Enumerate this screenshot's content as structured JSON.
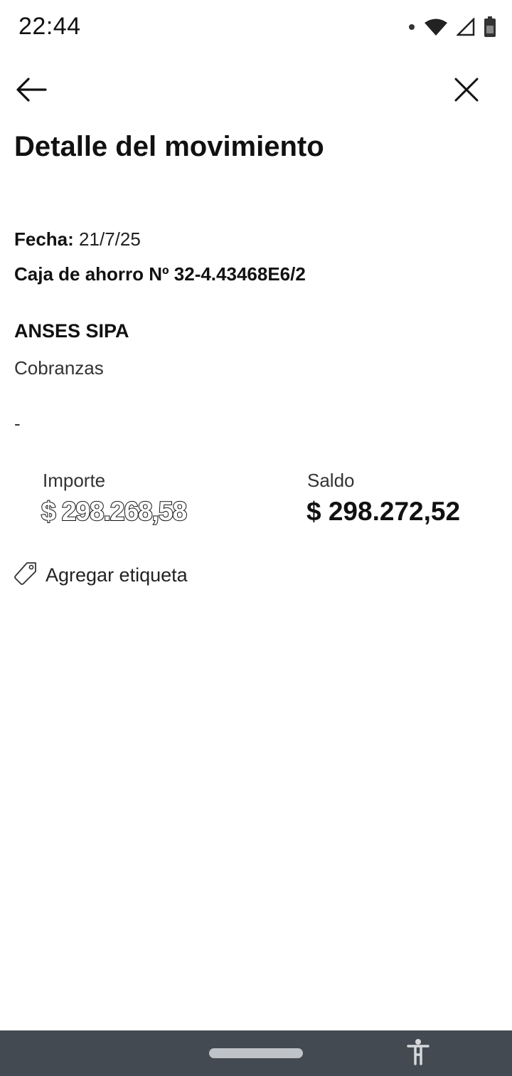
{
  "status_bar": {
    "time": "22:44",
    "icons": [
      "notification-dot-icon",
      "wifi-icon",
      "signal-icon",
      "battery-icon"
    ]
  },
  "header": {
    "back_icon": "arrow-left-icon",
    "close_icon": "close-icon",
    "title": "Detalle del movimiento"
  },
  "details": {
    "fecha_label": "Fecha:",
    "fecha_value": "21/7/25",
    "cuenta": "Caja de ahorro Nº 32-4.43468E6/2",
    "merchant": "ANSES SIPA",
    "category": "Cobranzas",
    "note": "-"
  },
  "amounts": {
    "importe_label": "Importe",
    "importe_value": "$ 298.268,58",
    "saldo_label": "Saldo",
    "saldo_value": "$ 298.272,52"
  },
  "tag": {
    "icon": "tag-icon",
    "label": "Agregar etiqueta"
  },
  "nav_bar": {
    "accessibility_icon": "accessibility-icon",
    "background": "#434a52"
  }
}
